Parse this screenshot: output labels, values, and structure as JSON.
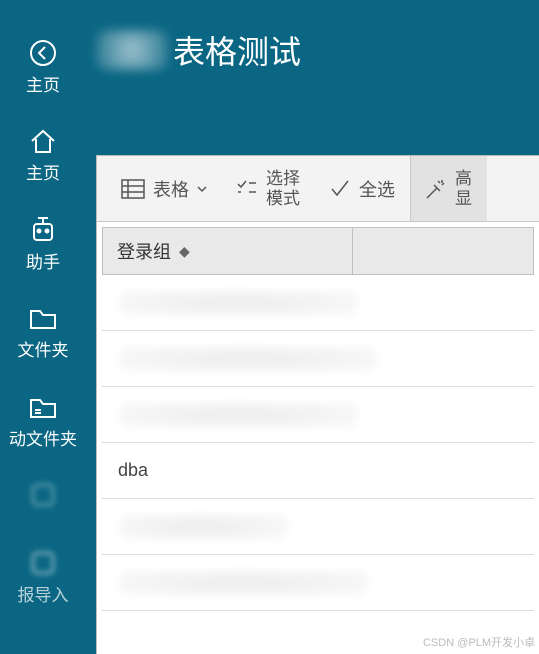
{
  "title": "表格测试",
  "sidebar": {
    "items": [
      {
        "label": "主页",
        "icon": "back"
      },
      {
        "label": "主页",
        "icon": "home"
      },
      {
        "label": "助手",
        "icon": "robot"
      },
      {
        "label": "文件夹",
        "icon": "folder"
      },
      {
        "label": "动文件夹",
        "icon": "folder-list"
      },
      {
        "label": "",
        "icon": "blur"
      },
      {
        "label": "报导入",
        "icon": "blur"
      }
    ]
  },
  "toolbar": {
    "table_btn": "表格",
    "select_mode_line1": "选择",
    "select_mode_line2": "模式",
    "select_all": "全选",
    "highlight_line1": "高",
    "highlight_line2": "显"
  },
  "table": {
    "column_header": "登录组",
    "rows": [
      "",
      "",
      "",
      "dba",
      "",
      ""
    ]
  },
  "watermark": "CSDN @PLM开发小卓"
}
